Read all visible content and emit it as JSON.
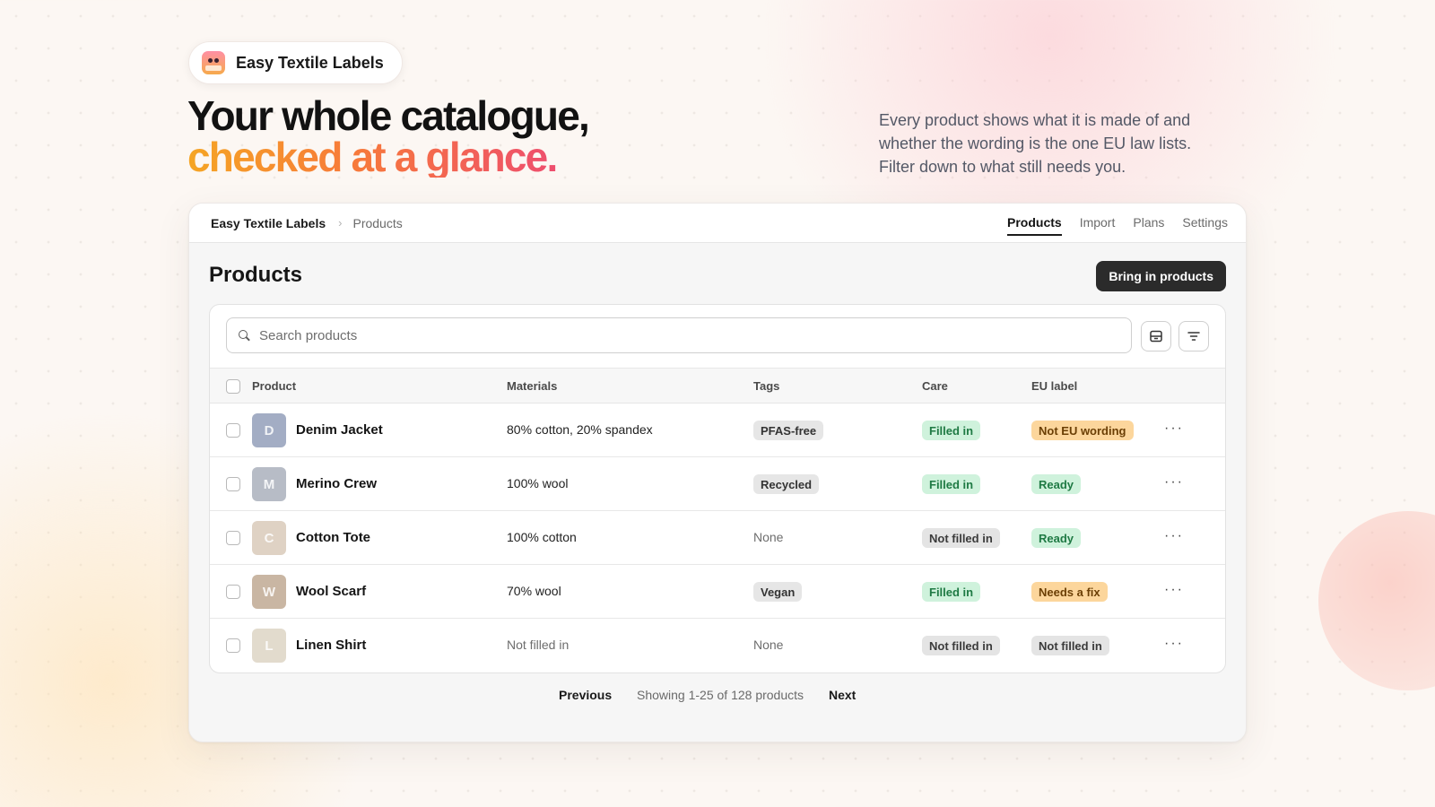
{
  "brand": {
    "name": "Easy Textile Labels",
    "logo_icon": "label-mascot-icon"
  },
  "hero": {
    "line1": "Your whole catalogue,",
    "line2": "checked at a glance.",
    "description": "Every product shows what it is made of and whether the wording is the one EU law lists. Filter down to what still needs you.",
    "gradient_colors": [
      "#f5a524",
      "#f77a3a",
      "#ee4e6e"
    ]
  },
  "app": {
    "breadcrumb": {
      "root": "Easy Textile Labels",
      "current": "Products"
    },
    "nav": [
      {
        "label": "Products",
        "active": true
      },
      {
        "label": "Import",
        "active": false
      },
      {
        "label": "Plans",
        "active": false
      },
      {
        "label": "Settings",
        "active": false
      }
    ],
    "page_title": "Products",
    "primary_action": "Bring in products",
    "search": {
      "placeholder": "Search products",
      "value": ""
    },
    "toolbar_icons": [
      "view-toggle-icon",
      "filter-icon"
    ],
    "columns": {
      "product": "Product",
      "materials": "Materials",
      "tags": "Tags",
      "care": "Care",
      "eu_label": "EU label"
    },
    "rows": [
      {
        "initial": "D",
        "avatar_color": "#a3adc4",
        "name": "Denim Jacket",
        "materials": "80% cotton, 20% spandex",
        "materials_empty": false,
        "tag": "PFAS-free",
        "care": "Filled in",
        "care_status": "green",
        "eu": "Not EU wording",
        "eu_status": "orange"
      },
      {
        "initial": "M",
        "avatar_color": "#b7bcc6",
        "name": "Merino Crew",
        "materials": "100% wool",
        "materials_empty": false,
        "tag": "Recycled",
        "care": "Filled in",
        "care_status": "green",
        "eu": "Ready",
        "eu_status": "green"
      },
      {
        "initial": "C",
        "avatar_color": "#dfd2c4",
        "name": "Cotton Tote",
        "materials": "100% cotton",
        "materials_empty": false,
        "tag": "None",
        "care": "Not filled in",
        "care_status": "gray",
        "eu": "Ready",
        "eu_status": "green"
      },
      {
        "initial": "W",
        "avatar_color": "#c9b6a3",
        "name": "Wool Scarf",
        "materials": "70% wool",
        "materials_empty": false,
        "tag": "Vegan",
        "care": "Filled in",
        "care_status": "green",
        "eu": "Needs a fix",
        "eu_status": "orange"
      },
      {
        "initial": "L",
        "avatar_color": "#e2dbcd",
        "name": "Linen Shirt",
        "materials": "Not filled in",
        "materials_empty": true,
        "tag": "None",
        "care": "Not filled in",
        "care_status": "gray",
        "eu": "Not filled in",
        "eu_status": "gray"
      }
    ],
    "row_menu_glyph": "···",
    "pager": {
      "previous": "Previous",
      "info": "Showing 1-25 of 128 products",
      "next": "Next"
    },
    "status_colors": {
      "green": {
        "bg": "#cff2dc",
        "fg": "#1f7a44"
      },
      "orange": {
        "bg": "#fcd69c",
        "fg": "#6b3f05"
      },
      "gray": {
        "bg": "#e4e4e4",
        "fg": "#3b3b3b"
      },
      "tag": {
        "bg": "#e6e6e6",
        "fg": "#333333"
      }
    }
  }
}
